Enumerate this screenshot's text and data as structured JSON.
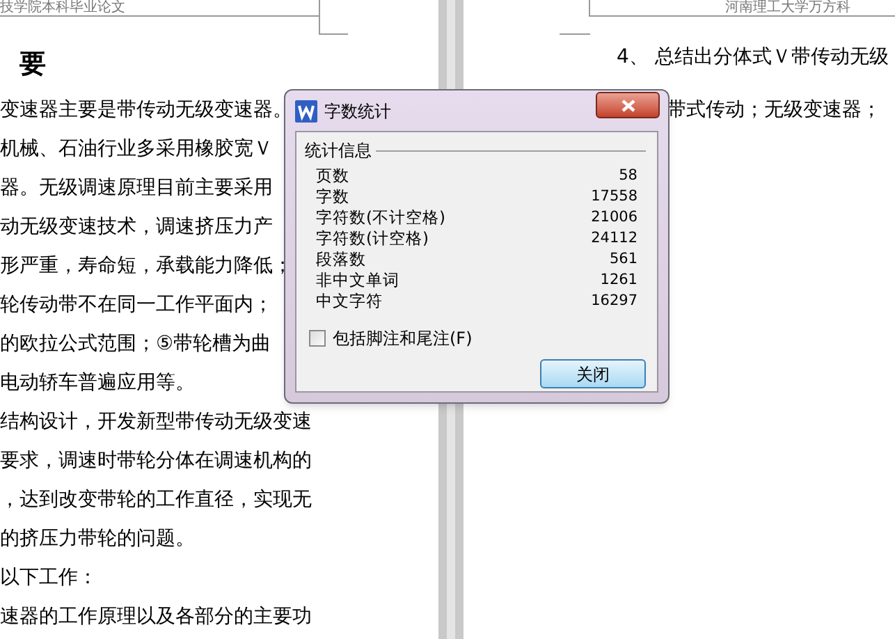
{
  "left_page": {
    "header": "技学院本科毕业论文",
    "heading": "要",
    "lines": [
      "变速器主要是带传动无级变速器。",
      "机械、石油行业多采用橡胶宽Ｖ",
      "器。无级调速原理目前主要采用",
      "动无级变速技术，调速挤压力产",
      "形严重，寿命短，承载能力降低；",
      "轮传动带不在同一工作平面内；",
      "的欧拉公式范围；⑤带轮槽为曲",
      "电动轿车普遍应用等。",
      "结构设计，开发新型带传动无级变速",
      "要求，调速时带轮分体在调速机构的",
      "，达到改变带轮的工作直径，实现无",
      "的挤压力带轮的问题。",
      "以下工作：",
      "速器的工作原理以及各部分的主要功"
    ]
  },
  "right_page": {
    "header": "河南理工大学万方科",
    "lines": [
      "4、 总结出分体式Ｖ带传动无级",
      "带式传动；无级变速器；"
    ]
  },
  "dialog": {
    "title": "字数统计",
    "group_label": "统计信息",
    "stats": [
      {
        "label": "页数",
        "value": "58"
      },
      {
        "label": "字数",
        "value": "17558"
      },
      {
        "label": "字符数(不计空格)",
        "value": "21006"
      },
      {
        "label": "字符数(计空格)",
        "value": "24112"
      },
      {
        "label": "段落数",
        "value": "561"
      },
      {
        "label": "非中文单词",
        "value": "1261"
      },
      {
        "label": "中文字符",
        "value": "16297"
      }
    ],
    "checkbox": {
      "label": "包括脚注和尾注(F)",
      "checked": false
    },
    "button": "关闭"
  }
}
